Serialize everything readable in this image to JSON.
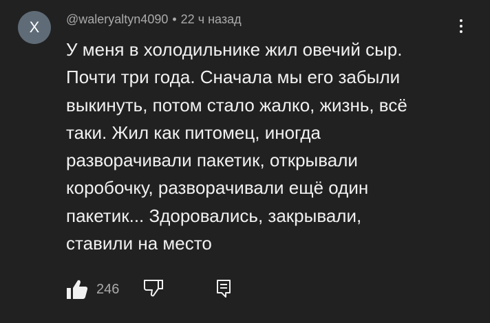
{
  "comment": {
    "avatar_letter": "X",
    "author": "@waleryaltyn4090",
    "separator": "•",
    "timestamp": "22 ч назад",
    "text_lines": [
      "У меня в холодильнике жил овечий сыр.",
      "Почти три года. Сначала мы его забыли",
      "выкинуть, потом стало жалко, жизнь, всё",
      "таки. Жил как питомец, иногда",
      "разворачивали пакетик, открывали",
      "коробочку, разворачивали ещё один",
      "пакетик... Здоровались, закрывали,",
      "ставили на место"
    ],
    "like_count": "246",
    "icons": {
      "menu": "more-vert-icon",
      "like": "thumb-up-icon",
      "dislike": "thumb-down-icon",
      "reply": "reply-icon"
    },
    "colors": {
      "background": "#212121",
      "avatar": "#5f6c77",
      "primary_text": "#f1f1f1",
      "secondary_text": "#aaaaaa"
    }
  }
}
